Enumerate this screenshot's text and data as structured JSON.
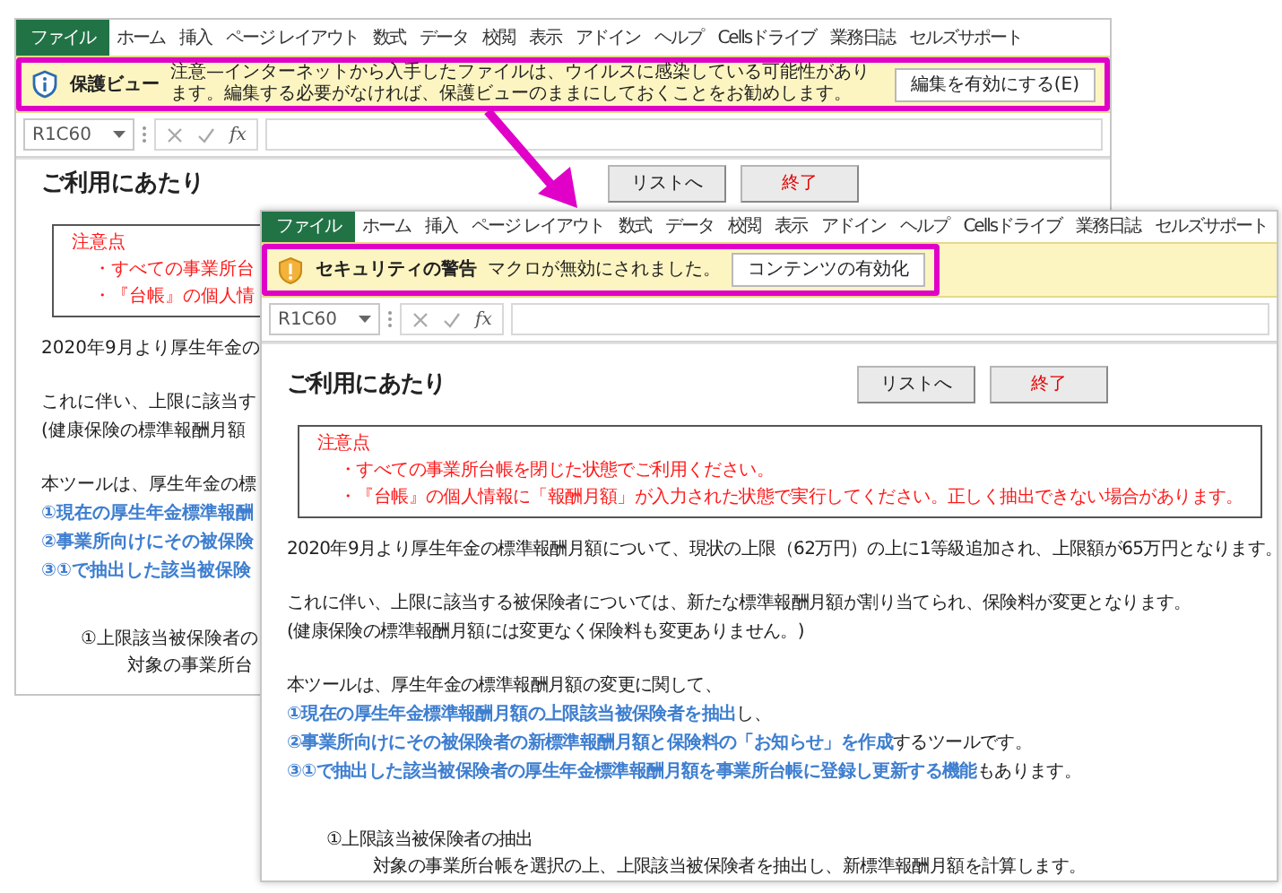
{
  "windows": [
    {
      "kind": "back",
      "menu_tabs": [
        {
          "label": "ファイル",
          "kind": "file"
        },
        {
          "label": "ホーム",
          "kind": "tab"
        },
        {
          "label": "挿入",
          "kind": "tab"
        },
        {
          "label": "ページ レイアウト",
          "kind": "tab"
        },
        {
          "label": "数式",
          "kind": "tab"
        },
        {
          "label": "データ",
          "kind": "tab"
        },
        {
          "label": "校閲",
          "kind": "tab"
        },
        {
          "label": "表示",
          "kind": "tab"
        },
        {
          "label": "アドイン",
          "kind": "tab"
        },
        {
          "label": "ヘルプ",
          "kind": "tab"
        },
        {
          "label": "Cellsドライブ",
          "kind": "tab"
        },
        {
          "label": "業務日誌",
          "kind": "tab"
        },
        {
          "label": "セルズサポート",
          "kind": "tab"
        }
      ],
      "message_bar": {
        "kind": "protected_view",
        "highlighted": true,
        "title": "保護ビュー",
        "message": "注意—インターネットから入手したファイルは、ウイルスに感染している可能性があります。編集する必要がなければ、保護ビューのままにしておくことをお勧めします。",
        "button": "編集を有効にする(E)"
      },
      "formula_bar": {
        "name_box": "R1C60",
        "function_label": "fx"
      },
      "sheet": {
        "title": "ご利用にあたり",
        "buttons": [
          {
            "label": "リストへ",
            "kind": "normal"
          },
          {
            "label": "終了",
            "kind": "danger"
          }
        ],
        "notice": {
          "heading": "注意点",
          "items": [
            "・すべての事業所台",
            "・『台帳』の個人情"
          ]
        },
        "blocks": [
          [
            [
              {
                "text": "2020年9月より厚生年金の",
                "highlight": false
              }
            ]
          ],
          [
            [
              {
                "text": "これに伴い、上限に該当す",
                "highlight": false
              }
            ],
            [
              {
                "text": "(健康保険の標準報酬月額",
                "highlight": false
              }
            ]
          ],
          [
            [
              {
                "text": "本ツールは、厚生年金の標",
                "highlight": false
              }
            ],
            [
              {
                "text": "①現在の厚生年金標準報酬",
                "highlight": true
              }
            ],
            [
              {
                "text": "②事業所向けにその被保険",
                "highlight": true
              }
            ],
            [
              {
                "text": "③①で抽出した該当被保険",
                "highlight": true
              }
            ]
          ]
        ],
        "steps": [
          {
            "title": "①上限該当被保険者の",
            "children": [
              {
                "title": "対象の事業所台"
              }
            ]
          }
        ]
      }
    },
    {
      "kind": "front",
      "menu_tabs": [
        {
          "label": "ファイル",
          "kind": "file"
        },
        {
          "label": "ホーム",
          "kind": "tab"
        },
        {
          "label": "挿入",
          "kind": "tab"
        },
        {
          "label": "ページ レイアウト",
          "kind": "tab"
        },
        {
          "label": "数式",
          "kind": "tab"
        },
        {
          "label": "データ",
          "kind": "tab"
        },
        {
          "label": "校閲",
          "kind": "tab"
        },
        {
          "label": "表示",
          "kind": "tab"
        },
        {
          "label": "アドイン",
          "kind": "tab"
        },
        {
          "label": "ヘルプ",
          "kind": "tab"
        },
        {
          "label": "Cellsドライブ",
          "kind": "tab"
        },
        {
          "label": "業務日誌",
          "kind": "tab"
        },
        {
          "label": "セルズサポート",
          "kind": "tab"
        }
      ],
      "message_bar": {
        "kind": "security_warning",
        "highlighted": true,
        "title": "セキュリティの警告",
        "message": "マクロが無効にされました。",
        "button": "コンテンツの有効化"
      },
      "formula_bar": {
        "name_box": "R1C60",
        "function_label": "fx"
      },
      "sheet": {
        "title": "ご利用にあたり",
        "buttons": [
          {
            "label": "リストへ",
            "kind": "normal"
          },
          {
            "label": "終了",
            "kind": "danger"
          }
        ],
        "notice": {
          "heading": "注意点",
          "items": [
            "・すべての事業所台帳を閉じた状態でご利用ください。",
            "・『台帳』の個人情報に「報酬月額」が入力された状態で実行してください。正しく抽出できない場合があります。"
          ]
        },
        "blocks": [
          [
            [
              {
                "text": "2020年9月より厚生年金の標準報酬月額について、現状の上限（62万円）の上に1等級追加され、上限額が65万円となります。",
                "highlight": false
              }
            ]
          ],
          [
            [
              {
                "text": "これに伴い、上限に該当する被保険者については、新たな標準報酬月額が割り当てられ、保険料が変更となります。",
                "highlight": false
              }
            ],
            [
              {
                "text": "(健康保険の標準報酬月額には変更なく保険料も変更ありません。)",
                "highlight": false
              }
            ]
          ],
          [
            [
              {
                "text": "本ツールは、厚生年金の標準報酬月額の変更に関して、",
                "highlight": false
              }
            ],
            [
              {
                "text": "①現在の厚生年金標準報酬月額の上限該当被保険者を抽出",
                "highlight": true
              },
              {
                "text": "し、",
                "highlight": false
              }
            ],
            [
              {
                "text": "②事業所向けにその被保険者の新標準報酬月額と保険料の「お知らせ」を作成",
                "highlight": true
              },
              {
                "text": "するツールです。",
                "highlight": false
              }
            ],
            [
              {
                "text": "③①で抽出した該当被保険者の厚生年金標準報酬月額を事業所台帳に登録し更新する機能",
                "highlight": true
              },
              {
                "text": "もあります。",
                "highlight": false
              }
            ]
          ]
        ],
        "steps": [
          {
            "title": "①上限該当被保険者の抽出",
            "children": [
              {
                "title": "対象の事業所台帳を選択の上、上限該当被保険者を抽出し、新標準報酬月額を計算します。"
              }
            ]
          }
        ]
      }
    }
  ]
}
